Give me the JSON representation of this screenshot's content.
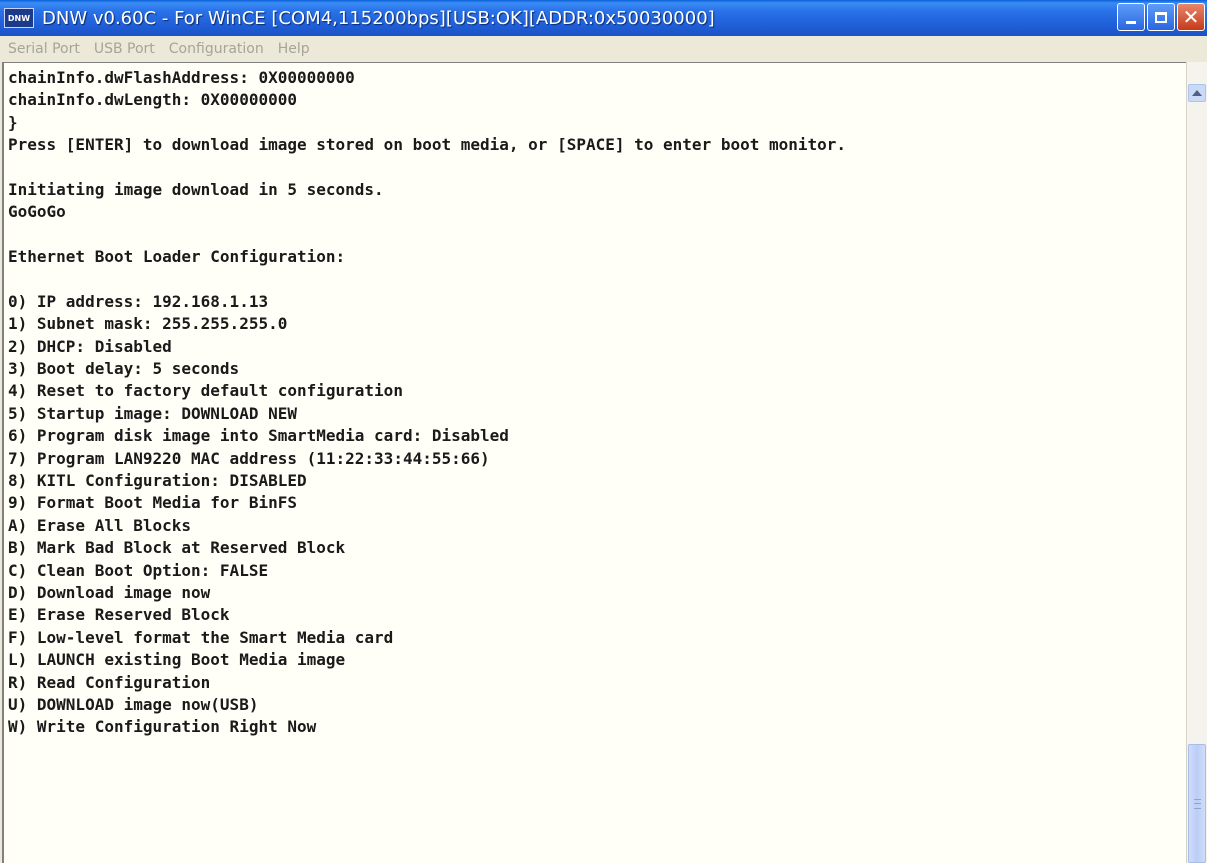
{
  "window": {
    "app_icon_text": "DNW",
    "title": "DNW v0.60C - For WinCE   [COM4,115200bps][USB:OK][ADDR:0x50030000]",
    "buttons": {
      "minimize": "minimize",
      "maximize": "maximize",
      "close": "close"
    }
  },
  "menu": {
    "items": [
      "Serial Port",
      "USB Port",
      "Configuration",
      "Help"
    ]
  },
  "console": {
    "lines": [
      "chainInfo.dwFlashAddress: 0X00000000",
      "chainInfo.dwLength: 0X00000000",
      "}",
      "Press [ENTER] to download image stored on boot media, or [SPACE] to enter boot monitor.",
      "",
      "Initiating image download in 5 seconds.",
      "GoGoGo",
      "",
      "Ethernet Boot Loader Configuration:",
      "",
      "0) IP address: 192.168.1.13",
      "1) Subnet mask: 255.255.255.0",
      "2) DHCP: Disabled",
      "3) Boot delay: 5 seconds",
      "4) Reset to factory default configuration",
      "5) Startup image: DOWNLOAD NEW",
      "6) Program disk image into SmartMedia card: Disabled",
      "7) Program LAN9220 MAC address (11:22:33:44:55:66)",
      "8) KITL Configuration: DISABLED",
      "9) Format Boot Media for BinFS",
      "A) Erase All Blocks",
      "B) Mark Bad Block at Reserved Block",
      "C) Clean Boot Option: FALSE",
      "D) Download image now",
      "E) Erase Reserved Block",
      "F) Low-level format the Smart Media card",
      "L) LAUNCH existing Boot Media image",
      "R) Read Configuration",
      "U) DOWNLOAD image now(USB)",
      "W) Write Configuration Right Now"
    ]
  },
  "scrollbar": {
    "position_fraction": 0.98,
    "icon": "scroll-up-arrow"
  },
  "colors": {
    "titlebar": "#1f5fd8",
    "close_button": "#c63a1a",
    "console_bg": "#fffff8",
    "menu_text_disabled": "#a7a498"
  }
}
